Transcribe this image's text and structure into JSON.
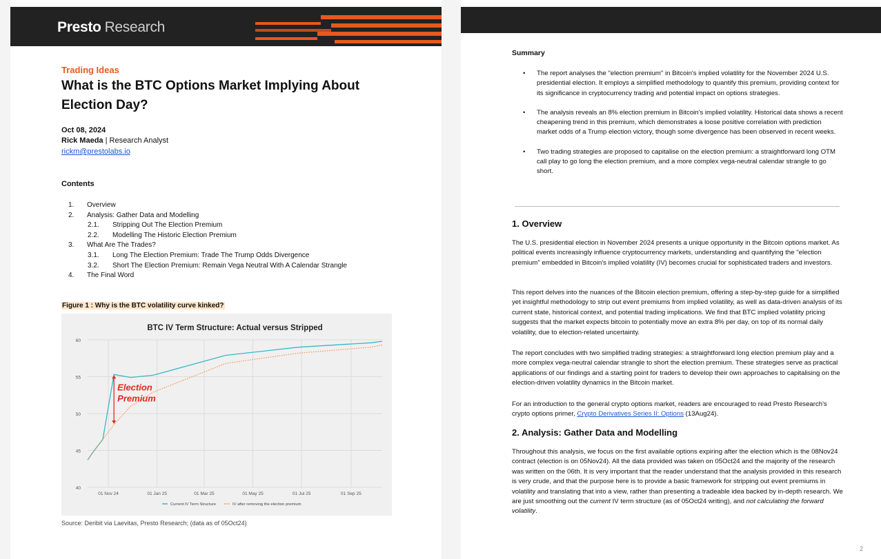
{
  "page1": {
    "logo": {
      "brand": "Presto",
      "sub": "Research"
    },
    "category": "Trading Ideas",
    "title": "What is the BTC Options Market Implying About Election Day?",
    "date": "Oct 08, 2024",
    "author_name": "Rick Maeda",
    "author_role": "| Research Analyst",
    "email": "rickm@prestolabs.io",
    "contents_title": "Contents",
    "toc": [
      {
        "num": "1.",
        "text": "Overview",
        "level": 1
      },
      {
        "num": "2.",
        "text": "Analysis: Gather Data and Modelling",
        "level": 1
      },
      {
        "num": "2.1.",
        "text": "Stripping Out The Election Premium",
        "level": 2
      },
      {
        "num": "2.2.",
        "text": "Modelling The Historic Election Premium",
        "level": 2
      },
      {
        "num": "3.",
        "text": "What Are The Trades?",
        "level": 1
      },
      {
        "num": "3.1.",
        "text": "Long The Election Premium: Trade The Trump Odds Divergence",
        "level": 2
      },
      {
        "num": "3.2.",
        "text": "Short The Election Premium: Remain Vega Neutral With A Calendar Strangle",
        "level": 2
      },
      {
        "num": "4.",
        "text": "The Final Word",
        "level": 1
      }
    ],
    "figure_title": "Figure 1 : Why is the BTC volatility curve kinked?",
    "source": "Source: Deribit via Laevitas, Presto Research; (data as of 05Oct24)"
  },
  "chart_data": {
    "type": "line",
    "title": "BTC IV Term Structure: Actual versus Stripped",
    "xlabel": "",
    "ylabel": "",
    "ylim": [
      40,
      60
    ],
    "yticks": [
      40,
      45,
      50,
      55,
      60
    ],
    "xtick_labels": [
      "01 Nov 24",
      "01 Jan 25",
      "01 Mar 25",
      "01 May 25",
      "01 Jul 25",
      "01 Sep 25"
    ],
    "xtick_positions": [
      "2024-11-01",
      "2025-01-01",
      "2025-03-01",
      "2025-05-01",
      "2025-07-01",
      "2025-09-01"
    ],
    "xlim": [
      "2024-10-06",
      "2025-10-10"
    ],
    "grid": true,
    "legend_position": "bottom",
    "annotation": {
      "text": [
        "Election",
        "Premium"
      ],
      "x": "2024-11-08",
      "y_top": 55.3,
      "y_bottom": 48.5
    },
    "series": [
      {
        "name": "Current IV Term Structure",
        "color": "#35b8c4",
        "dashed": false,
        "x": [
          "2024-10-06",
          "2024-10-13",
          "2024-10-25",
          "2024-11-08",
          "2024-11-29",
          "2024-12-27",
          "2025-03-28",
          "2025-06-27",
          "2025-09-26",
          "2025-10-10"
        ],
        "y": [
          43.7,
          44.8,
          46.5,
          55.3,
          54.9,
          55.2,
          57.9,
          59.0,
          59.6,
          59.8
        ]
      },
      {
        "name": "IV after removing the election premium",
        "color": "#f08a3c",
        "dashed": true,
        "x": [
          "2024-10-06",
          "2024-10-13",
          "2024-10-25",
          "2024-11-08",
          "2024-11-29",
          "2024-12-27",
          "2025-03-28",
          "2025-06-27",
          "2025-09-26",
          "2025-10-10"
        ],
        "y": [
          43.7,
          44.8,
          46.5,
          48.5,
          51.0,
          52.9,
          56.8,
          58.2,
          59.0,
          59.3
        ]
      }
    ]
  },
  "page2": {
    "summary_title": "Summary",
    "bullets": [
      "The report analyses the \"election premium\" in Bitcoin's implied volatility for the November 2024 U.S. presidential election. It employs a simplified methodology to quantify this premium, providing context for its significance in cryptocurrency trading and potential impact on options strategies.",
      "The analysis reveals an 8% election premium in Bitcoin's implied volatility. Historical data shows a recent cheapening trend in this premium, which demonstrates a loose positive correlation with prediction market odds of a Trump election victory, though some divergence has been observed in recent weeks.",
      "Two trading strategies are proposed to capitalise on the election premium: a straightforward long OTM call play to go long the election premium, and a more complex vega-neutral calendar strangle to go short."
    ],
    "overview_title": "1. Overview",
    "overview_paras": [
      "The U.S. presidential election in November 2024 presents a unique opportunity in the Bitcoin options market. As political events increasingly influence cryptocurrency markets, understanding and quantifying the \"election premium\" embedded in Bitcoin's implied volatility (IV) becomes crucial for sophisticated traders and investors.",
      "This report delves into the nuances of the Bitcoin election premium, offering a step-by-step guide for a simplified yet insightful methodology to strip out event premiums from implied volatility, as well as data-driven analysis of its current state, historical context, and potential trading implications. We find that BTC implied volatility pricing suggests that the market expects bitcoin to potentially move an extra 8% per day, on top of its normal daily volatility, due to election-related uncertainty.",
      "The report concludes with two simplified trading strategies: a straightforward long election premium play and a more complex vega-neutral calendar strangle to short the election premium. These strategies serve as practical applications of our findings and a starting point for traders to develop their own approaches to capitalising on the election-driven volatility dynamics in the Bitcoin market."
    ],
    "intro_pre": "For an introduction to the general crypto options market, readers are encouraged to read Presto Research's crypto options primer, ",
    "intro_link": "Crypto Derivatives Series II: Options",
    "intro_post": " (13Aug24).",
    "analysis_title": "2. Analysis: Gather Data and Modelling",
    "analysis_pre": "Throughout this analysis, we focus on the first available options expiring after the election which is the 08Nov24 contract (election is on 05Nov24). All the data provided was taken on 05Oct24 and the majority of the research was written on the 06th. It is very important that the reader understand that the analysis provided in this research is very crude, and that the purpose here is to provide a basic framework for stripping out event premiums in volatility and translating that into a view, rather than presenting a tradeable idea backed by in-depth research. We are just smoothing out the ",
    "analysis_em1": "current",
    "analysis_mid": " IV term structure (as of 05Oct24 writing), and ",
    "analysis_em2": "not calculating the forward volatility",
    "analysis_end": ".",
    "page_number": "2"
  }
}
